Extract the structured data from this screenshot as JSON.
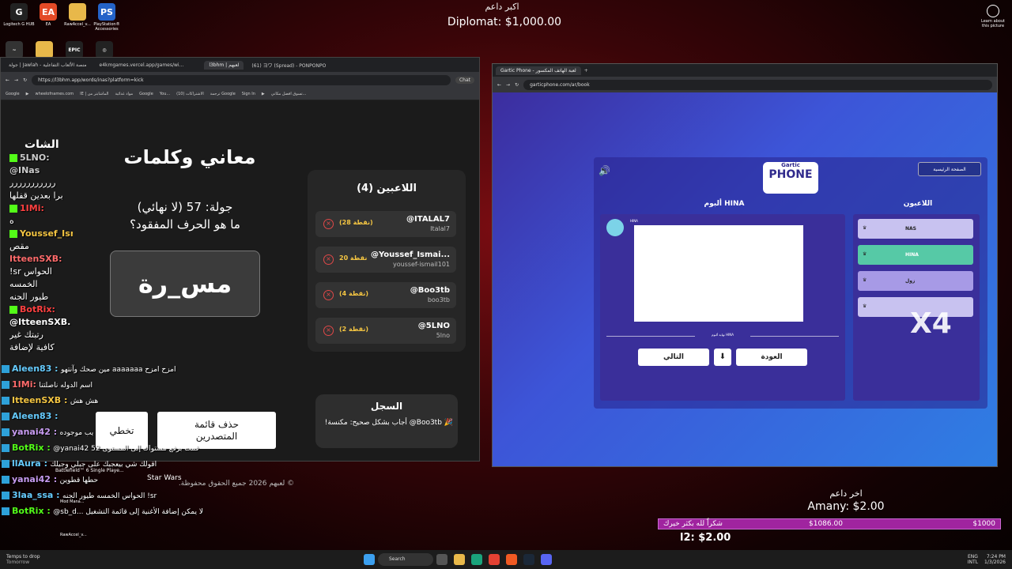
{
  "desktop": {
    "icons": [
      {
        "label": "Logitech G HUB",
        "glyph": "G",
        "color": "#222"
      },
      {
        "label": "EA",
        "glyph": "EA",
        "color": "#e34a26"
      },
      {
        "label": "RawAccel_v...",
        "glyph": "",
        "color": "#e8b84a"
      },
      {
        "label": "PlayStation® Accessories",
        "glyph": "PS",
        "color": "#2463c8"
      }
    ],
    "row2_icons": [
      {
        "label": "",
        "glyph": "~",
        "color": "#333"
      },
      {
        "label": "",
        "glyph": "",
        "color": "#e8b84a"
      },
      {
        "label": "",
        "glyph": "EPIC",
        "color": "#222"
      },
      {
        "label": "",
        "glyph": "◎",
        "color": "#222"
      }
    ],
    "learn_about": "Learn about this picture"
  },
  "overlay": {
    "top_donor_title": "اكبر داعم",
    "top_donor": "Diplomat: $1,000.00",
    "last_donor_title": "اخر داعم",
    "last_donor": "Amany: $2.00",
    "goal_label": "شكراًً لله بكثر خيرك",
    "goal_current": "$1086.00",
    "goal_target": "$1000",
    "goal_progress": 1.0,
    "small_donation": "l2: $2.00"
  },
  "left_browser": {
    "tabs": [
      "جولة | Jawlah - منصة الألعاب التفاعلية",
      "e4kmgames.vercel.app/games/wi...",
      "",
      "l3bhm | لعبهم",
      "(61) ヨワ (Spread) - PONPONPO"
    ],
    "url": "https://l3bhm.app/words/inas?platform=kick",
    "chat_btn": "Chat",
    "bookmarks": [
      "Google",
      "",
      "wheelofnames.com",
      "IE | الماشابتر من",
      "مواد غذائية",
      "Google",
      "You...",
      "(10) الاشتراكات",
      "ترجمة Google",
      "Sign In",
      "",
      "تسوق افضل مكاني..."
    ],
    "chat_header": "الشات",
    "game_title": "معاني وكلمات",
    "round": "جولة: 57 (لا نهائي)",
    "question": "ما هو الحرف المفقود؟",
    "word": "مس_رة",
    "skip": "تخطي",
    "delete_leaders": "حذف قائمة المتصدرين",
    "players_title": "اللاعبين (4)",
    "players": [
      {
        "name": "@ITALAL7",
        "handle": "Italal7",
        "points": "(28 نقطة)"
      },
      {
        "name": "@Youssef_Ismai...",
        "handle": "youssef-ismail101",
        "points": "20 نقطة"
      },
      {
        "name": "@Boo3tb",
        "handle": "boo3tb",
        "points": "(4 نقطة)"
      },
      {
        "name": "@5LNO",
        "handle": "5lno",
        "points": "(2 نقطة)"
      }
    ],
    "log_title": "السجل",
    "log_entry": "🎉 Boo3tb@ أجاب بشكل صحيح: مكنسة!",
    "footer": "© لعبهم 2026 جميع الحقوق محفوظة."
  },
  "chat_lines": [
    {
      "user": "5LNO:",
      "text": "",
      "badge": "green",
      "color": "#cccccc"
    },
    {
      "user": "@INas",
      "text": "",
      "badge": "",
      "color": "#cccccc"
    },
    {
      "user": "",
      "text": "ررررررررررر",
      "badge": "",
      "color": "#fff"
    },
    {
      "user": "",
      "text": "برا بعدين قفلها",
      "badge": "",
      "color": "#fff"
    },
    {
      "user": "1IMi:",
      "text": "",
      "badge": "green",
      "color": "#ff4040"
    },
    {
      "user": "",
      "text": "ه",
      "badge": "",
      "color": "#fff"
    },
    {
      "user": "Youssef_Isma",
      "text": "",
      "badge": "green",
      "color": "#f4c542"
    },
    {
      "user": "",
      "text": "مقص",
      "badge": "",
      "color": "#fff"
    },
    {
      "user": "ItteenSXB:",
      "text": "",
      "badge": "",
      "color": "#ff6b6b"
    },
    {
      "user": "",
      "text": "!sr الحواس",
      "badge": "",
      "color": "#fff"
    },
    {
      "user": "",
      "text": "الخمسه",
      "badge": "",
      "color": "#fff"
    },
    {
      "user": "",
      "text": "طيور الجنه",
      "badge": "",
      "color": "#fff"
    },
    {
      "user": "BotRix:",
      "text": "",
      "badge": "green",
      "color": "#ff4040"
    },
    {
      "user": "@ItteenSXB.",
      "text": "",
      "badge": "",
      "color": "#fff"
    },
    {
      "user": "",
      "text": "رتبتك غير",
      "badge": "",
      "color": "#fff"
    },
    {
      "user": "",
      "text": "كافية لإضافة",
      "badge": "",
      "color": "#fff"
    }
  ],
  "chat_lines2": [
    {
      "user": "Aleen83 :",
      "text": "مين صحك وآنتهو aaaaaaa امزح امزح",
      "color": "#6cf"
    },
    {
      "user": "1IMi:",
      "text": "اسم الدوله ناصلتنا",
      "color": "#ff6b6b"
    },
    {
      "user": "ItteenSXB :",
      "text": "هش هش",
      "color": "#f4c542"
    },
    {
      "user": "Aleen83 :",
      "text": "",
      "color": "#6cf"
    },
    {
      "user": "yanai42 :",
      "text": "يب موجوده",
      "color": "#c89cf2"
    },
    {
      "user": "BotRix :",
      "text": "@yanai42 قمت برفع مستواك إلى المستوى 52",
      "color": "#53fc18"
    },
    {
      "user": "llAura :",
      "text": "اقولك شي بيعجبك على جبلي وجيلك",
      "color": "#6cf"
    },
    {
      "user": "yanai42 :",
      "text": "حطها قطوين",
      "color": "#c89cf2"
    },
    {
      "user": "3laa_ssa :",
      "text": "الحواس الخمسه طيور الجنه !sr",
      "color": "#6cf"
    },
    {
      "user": "BotRix :",
      "text": "@sb_d... لا يمكن إضافة الأغنية إلى قائمة التشغيل",
      "color": "#53fc18"
    }
  ],
  "right_browser": {
    "tab": "Gartic Phone - لعبة الهاتف المكسور",
    "url": "garticphone.com/ar/book",
    "home_btn": "الصفحة الرئيسية",
    "logo_small": "Gartic",
    "logo": "PHONE",
    "album_title": "ألبوم HINA",
    "players_title": "اللاعبون",
    "album_user": "HINA",
    "album_end": "نهاية ألبوم HINA",
    "next": "التالي",
    "back": "العودة",
    "players": [
      "NAS",
      "HINA",
      "زول",
      ""
    ],
    "x4": "X4"
  },
  "desktop_items": {
    "bf6": "Battlefield™ 6 Single Playe...",
    "starwars": "Star Wars",
    "modman": "Mod Mana...",
    "rawaccel": "RawAccel_v..."
  },
  "taskbar": {
    "weather": "Temps to drop",
    "weather_sub": "Tomorrow",
    "search": "Search",
    "lang": "ENG",
    "lang2": "INTL",
    "time": "7:24 PM",
    "date": "1/3/2026"
  }
}
